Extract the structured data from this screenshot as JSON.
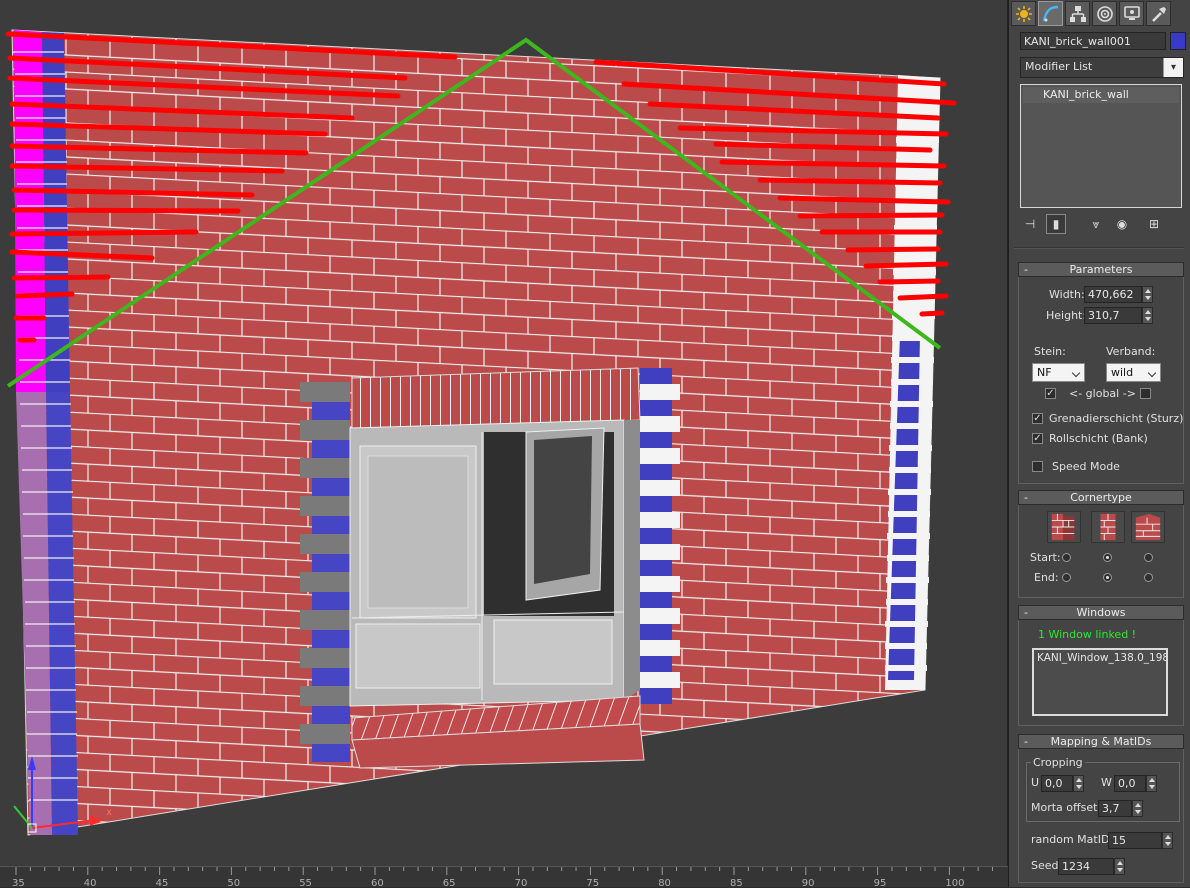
{
  "panel": {
    "object_name": "KANI_brick_wall001",
    "object_color": "#3a3ac8",
    "modifier_list": "Modifier List",
    "stack_item": "KANI_brick_wall",
    "tabs": [
      "create-icon",
      "modify-icon",
      "hierarchy-icon",
      "motion-icon",
      "display-icon",
      "utilities-icon"
    ]
  },
  "parameters": {
    "title": "Parameters",
    "width_label": "Width:",
    "width_value": "470,662",
    "height_label": "Height:",
    "height_value": "310,7",
    "stein_label": "Stein:",
    "stein_value": "NF",
    "verband_label": "Verband:",
    "verband_value": "wild",
    "global_label": "<- global ->",
    "grenadier_label": "Grenadierschicht (Sturz)",
    "rollschicht_label": "Rollschicht (Bank)",
    "speed_label": "Speed Mode"
  },
  "cornertype": {
    "title": "Cornertype",
    "start_label": "Start:",
    "end_label": "End:",
    "start_selected": 1,
    "end_selected": 1
  },
  "windows": {
    "title": "Windows",
    "status": "1 Window linked !",
    "item": "KANI_Window_138.0_198."
  },
  "mapping": {
    "title": "Mapping & MatIDs",
    "cropping_label": "Cropping",
    "u_label": "U",
    "u_value": "0,0",
    "w_label": "W",
    "w_value": "0,0",
    "morta_label": "Morta offset:",
    "morta_value": "3,7",
    "random_label": "random MatIDs",
    "random_value": "15",
    "seed_label": "Seed",
    "seed_value": "1234"
  },
  "ruler": {
    "labels": [
      "35",
      "40",
      "45",
      "50",
      "55",
      "60",
      "65",
      "70",
      "75",
      "80",
      "85",
      "90",
      "95",
      "100"
    ]
  },
  "viewport": {
    "axis_x": "x",
    "colors": {
      "brick": "#bb4a4b",
      "mortar": "#f2f2f2",
      "marker_red": "#ff0000",
      "marker_green": "#3cb81c",
      "corner_blue": "#3f3fc0",
      "corner_magenta": "#ff00ff"
    }
  }
}
